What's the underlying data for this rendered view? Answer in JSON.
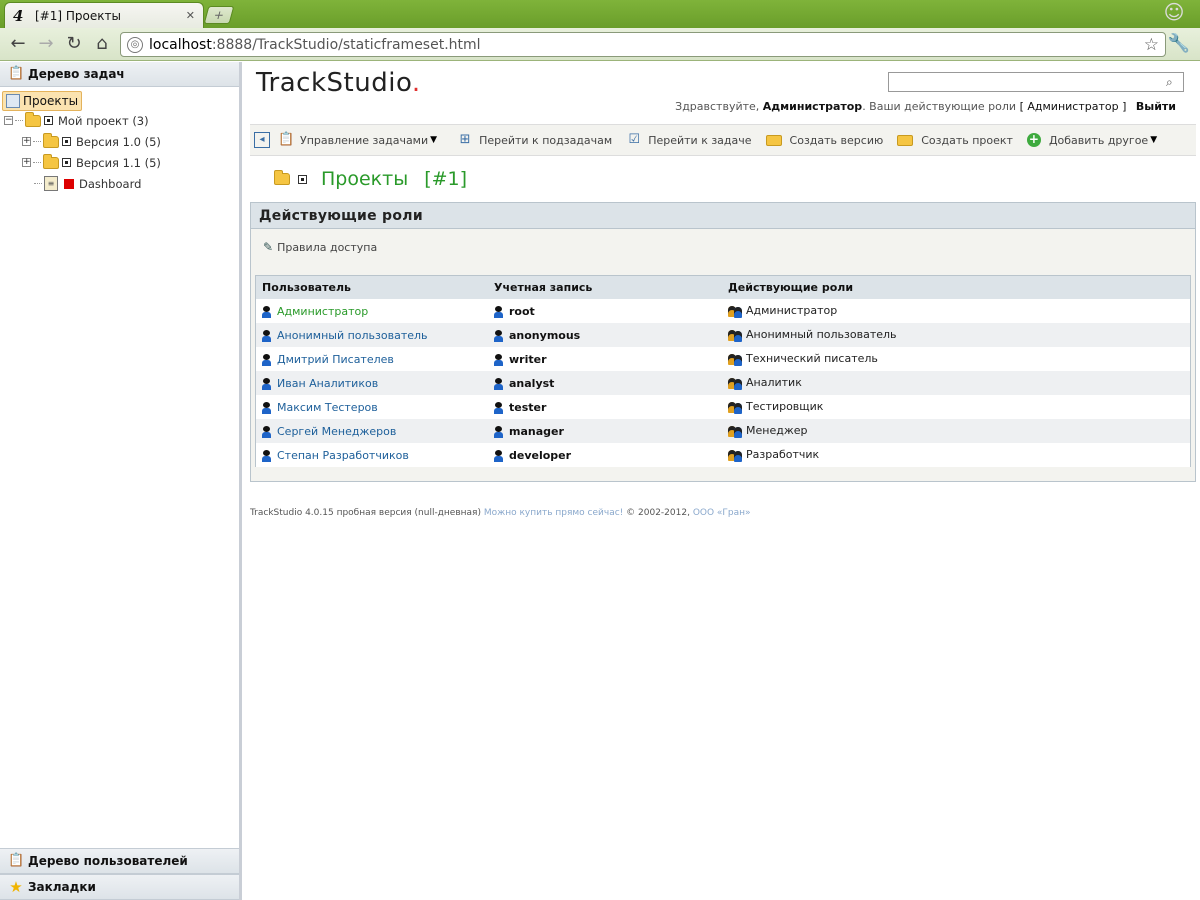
{
  "browser": {
    "tab_title": "[#1] Проекты",
    "tab_favicon": "4",
    "url_host": "localhost",
    "url_rest": ":8888/TrackStudio/staticframeset.html"
  },
  "sidebar": {
    "task_tree_title": "Дерево задач",
    "root_label": "Проекты",
    "items": [
      {
        "label": "Мой проект (3)"
      },
      {
        "label": "Версия 1.0 (5)"
      },
      {
        "label": "Версия 1.1 (5)"
      },
      {
        "label": "Dashboard"
      }
    ],
    "user_tree_title": "Дерево пользователей",
    "bookmarks_title": "Закладки"
  },
  "header": {
    "logo_text": "TrackStudio",
    "logo_dot": ".",
    "search_value": "",
    "greeting_prefix": "Здравствуйте,",
    "user_name": "Администратор",
    "roles_prefix": ". Ваши действующие роли",
    "current_role": "[ Администратор ]",
    "logout": "Выйти"
  },
  "actions": {
    "manage_tasks": "Управление задачами",
    "go_subtasks": "Перейти к подзадачам",
    "go_task": "Перейти к задаче",
    "create_version": "Создать версию",
    "create_project": "Создать проект",
    "add_other": "Добавить другое"
  },
  "page": {
    "title": "Проекты",
    "number": "[#1]"
  },
  "roles_panel": {
    "title": "Действующие роли",
    "access_rules": "Правила доступа",
    "columns": [
      "Пользователь",
      "Учетная запись",
      "Действующие роли"
    ],
    "rows": [
      {
        "user": "Администратор",
        "account": "root",
        "role": "Администратор"
      },
      {
        "user": "Анонимный пользователь",
        "account": "anonymous",
        "role": "Анонимный пользователь"
      },
      {
        "user": "Дмитрий Писателев",
        "account": "writer",
        "role": "Технический писатель"
      },
      {
        "user": "Иван Аналитиков",
        "account": "analyst",
        "role": "Аналитик"
      },
      {
        "user": "Максим Тестеров",
        "account": "tester",
        "role": "Тестировщик"
      },
      {
        "user": "Сергей Менеджеров",
        "account": "manager",
        "role": "Менеджер"
      },
      {
        "user": "Степан Разработчиков",
        "account": "developer",
        "role": "Разработчик"
      }
    ]
  },
  "footer": {
    "version_text": "TrackStudio 4.0.15 пробная версия (null-дневная)",
    "buy_link": "Можно купить прямо сейчас!",
    "copyright": "© 2002-2012,",
    "company_link": "ООО «Гран»"
  },
  "colors": {
    "accent_green": "#2a9a2a",
    "link_blue": "#1d5f9a",
    "chrome_green": "#7fb33a"
  }
}
